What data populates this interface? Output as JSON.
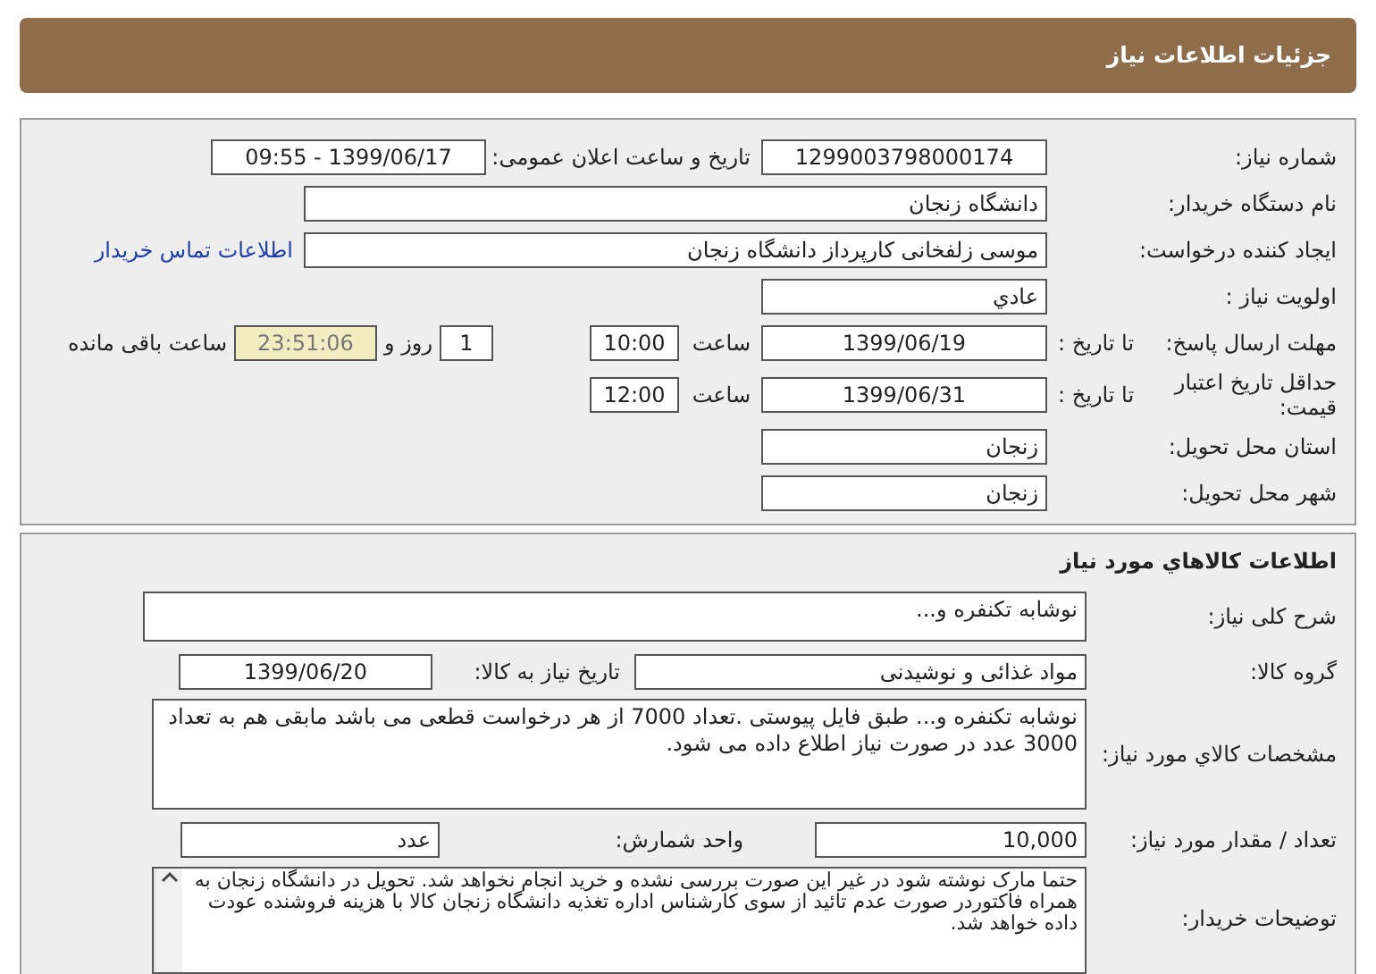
{
  "header": {
    "title": "جزئیات اطلاعات نیاز"
  },
  "need_details": {
    "need_number": {
      "label": "شماره نیاز:",
      "value": "1299003798000174"
    },
    "announce": {
      "label": "تاریخ و ساعت اعلان عمومی:",
      "value": "1399/06/17 - 09:55"
    },
    "buyer": {
      "label": "نام دستگاه خریدار:",
      "value": "دانشگاه زنجان"
    },
    "requester": {
      "label": "ایجاد کننده درخواست:",
      "value": "موسی زلفخانی کارپرداز دانشگاه زنجان"
    },
    "contact_link": "اطلاعات تماس خریدار",
    "priority": {
      "label": "اولویت نیاز :",
      "value": "عادي"
    },
    "deadline": {
      "label": "مهلت ارسال پاسخ:",
      "to_label": "تا تاریخ :",
      "date": "1399/06/19",
      "time_label": "ساعت",
      "time": "10:00",
      "days": "1",
      "days_label": "روز و",
      "remaining": "23:51:06",
      "remaining_label": "ساعت باقی مانده"
    },
    "validity": {
      "label": "حداقل تاریخ اعتبار قیمت:",
      "to_label": "تا تاریخ :",
      "date": "1399/06/31",
      "time_label": "ساعت",
      "time": "12:00"
    },
    "province": {
      "label": "استان محل تحویل:",
      "value": "زنجان"
    },
    "city": {
      "label": "شهر محل تحویل:",
      "value": "زنجان"
    }
  },
  "goods": {
    "title": "اطلاعات کالاهاي مورد نیاز",
    "summary": {
      "label": "شرح کلی نیاز:",
      "value": "نوشابه تکنفره و..."
    },
    "group": {
      "label": "گروه کالا:",
      "value": "مواد غذائی و نوشیدنی"
    },
    "need_date": {
      "label": "تاریخ نیاز به کالا:",
      "value": "1399/06/20"
    },
    "specs": {
      "label": "مشخصات کالاي مورد نیاز:",
      "value": "نوشابه تکنفره و... طبق فایل پیوستی .تعداد 7000 از هر درخواست قطعی می باشد مابقی هم به تعداد 3000 عدد در صورت نیاز اطلاع داده می شود."
    },
    "quantity": {
      "label": "تعداد / مقدار مورد نیاز:",
      "value": "10,000"
    },
    "unit": {
      "label": "واحد شمارش:",
      "value": "عدد"
    },
    "buyer_notes": {
      "label": "توضیحات خریدار:",
      "value": "حتما مارک نوشته شود در غیر این صورت بررسی نشده و خرید انجام نخواهد شد. تحویل در دانشگاه زنجان به همراه فاکتوردر صورت عدم تائید از سوی کارشناس اداره تغذیه دانشگاه زنجان کالا با هزینه فروشنده عودت داده خواهد شد."
    }
  }
}
